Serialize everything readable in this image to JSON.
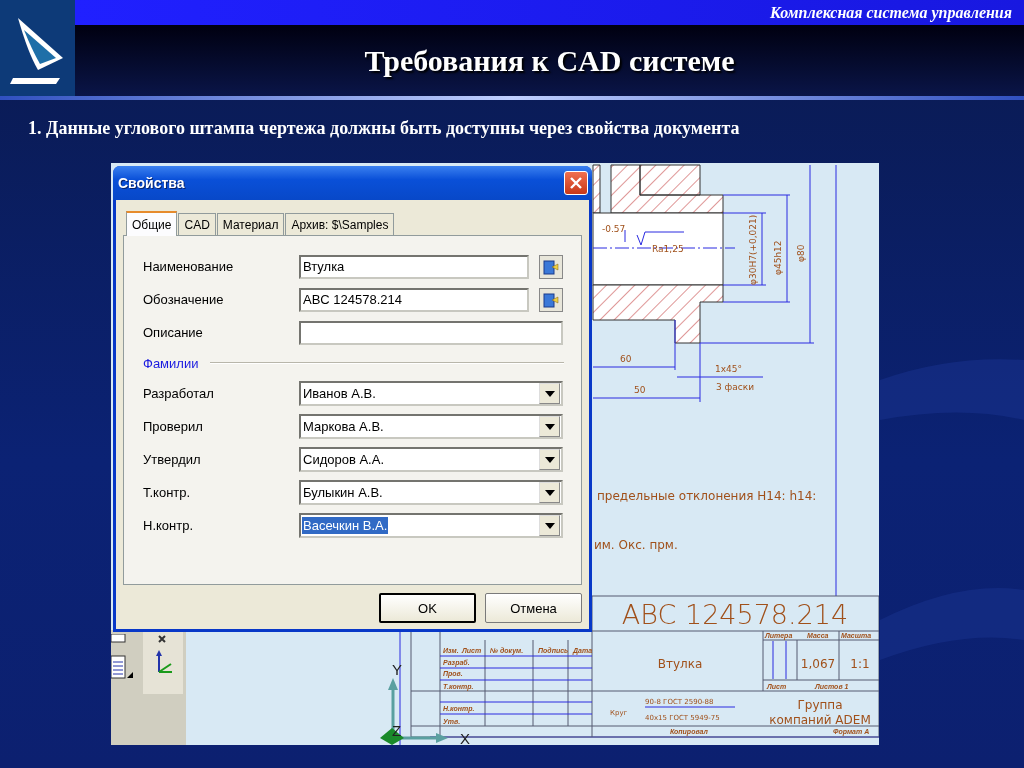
{
  "slide": {
    "header": "Комплексная система управления",
    "title": "Требования к CAD системе",
    "bullet": "1. Данные углового штампа чертежа должны быть доступны через свойства документа"
  },
  "dialog": {
    "title": "Свойства",
    "tabs": [
      {
        "label": "Общие",
        "selected": true
      },
      {
        "label": "CAD",
        "selected": false
      },
      {
        "label": "Материал",
        "selected": false
      },
      {
        "label": "Архив: $\\Samples",
        "selected": false
      }
    ],
    "fields": [
      {
        "label": "Наименование",
        "value": "Втулка",
        "kind": "link"
      },
      {
        "label": "Обозначение",
        "value": "ABC 124578.214",
        "kind": "link"
      },
      {
        "label": "Описание",
        "kind": "text"
      }
    ],
    "section": "Фамилии",
    "people": [
      {
        "label": "Разработал",
        "value": "Иванов А.В.",
        "selected": false
      },
      {
        "label": "Проверил",
        "value": "Маркова А.В.",
        "selected": false
      },
      {
        "label": "Утвердил",
        "value": "Сидоров А.А.",
        "selected": false
      },
      {
        "label": "Т.контр.",
        "value": "Булыкин А.В.",
        "selected": false
      },
      {
        "label": "Н.контр.",
        "value": "Васечкин В.А.",
        "selected": true
      }
    ],
    "buttons": [
      {
        "label": "OK",
        "default": true
      },
      {
        "label": "Отмена",
        "default": false
      }
    ]
  },
  "drawing": {
    "tolerance": "-0.57",
    "roughness": "Ra1,25",
    "bore": "φ30H7(+0,021)",
    "hub": "φ45h12",
    "flange": "φ80",
    "length_1": "60",
    "length_2": "50",
    "chamfer": "1x45°",
    "chamfer_note": "3 фаски",
    "note_1": "предельные отклонения H14: h14:",
    "note_2": "им. Окс. прм.",
    "axes": [
      "Y",
      "Z",
      "X"
    ]
  },
  "title_block": {
    "designation": "ABC 124578.214",
    "part_name": "Втулка",
    "headers": [
      "Литера",
      "Масса",
      "Масшта"
    ],
    "mass": "1,067",
    "scale": "1:1",
    "sheet": "Лист",
    "sheets": "Листов 1",
    "company": [
      "Группа",
      "компаний ADEM"
    ],
    "material_label": "Круг",
    "material": [
      "90-8 ГОСТ 2590-88",
      "40x15 ГОСТ 5949-75"
    ],
    "copied": "Копировал",
    "format": "Формат А",
    "columns": [
      "Изм.",
      "Лист",
      "№ докум.",
      "Подпись",
      "Дата"
    ],
    "roles": [
      "Разраб.",
      "Пров.",
      "Т.контр.",
      "Н.контр.",
      "Утв."
    ]
  }
}
